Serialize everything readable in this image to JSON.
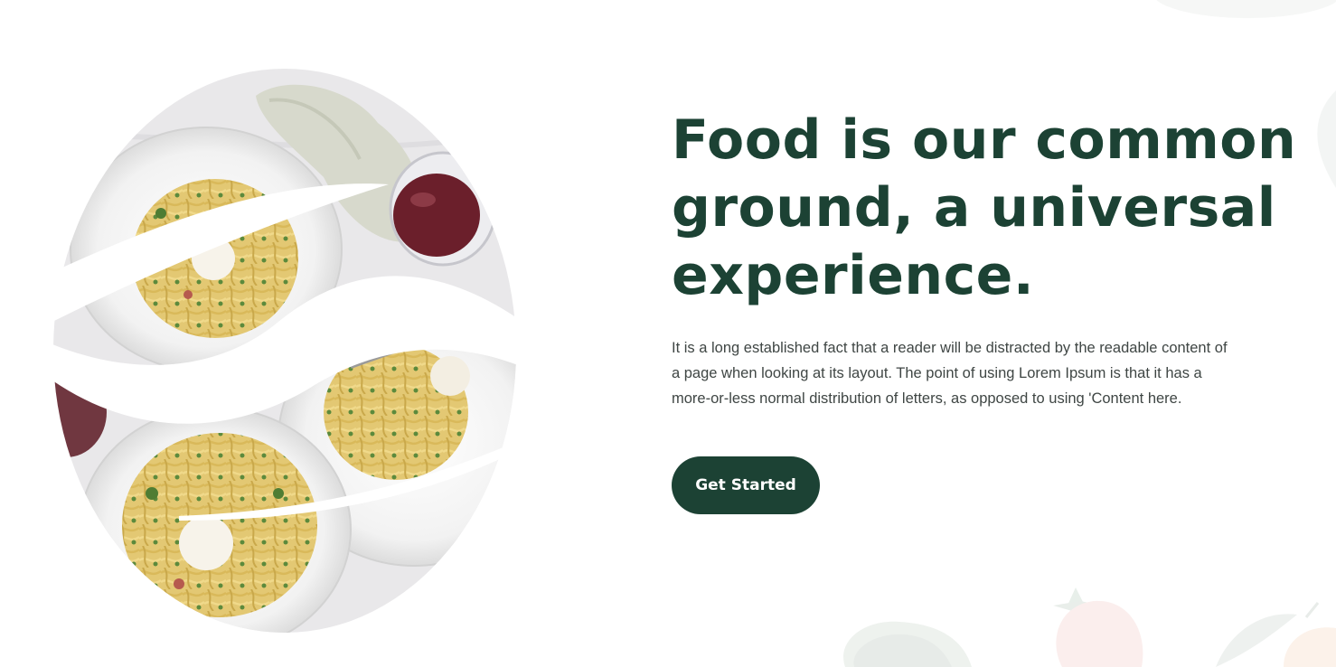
{
  "hero": {
    "headline_lines": [
      "Food is our common",
      "ground, a universal",
      "experience."
    ],
    "body": "It is a long established fact that a reader will be distracted by the readable content of a page when looking at its layout. The point of using Lorem Ipsum is that it has a more-or-less normal distribution of letters, as opposed to using 'Content here.",
    "cta_label": "Get Started"
  },
  "image": {
    "subject": "plates of spaghetti with greens and burrata, glass of red wine, linen napkin"
  },
  "decorations": [
    "leaf-icon",
    "strawberry-icon",
    "peach-icon",
    "blob-shape"
  ],
  "colors": {
    "brand_dark_green": "#1c4234",
    "body_text": "#3f4644",
    "background": "#ffffff"
  }
}
